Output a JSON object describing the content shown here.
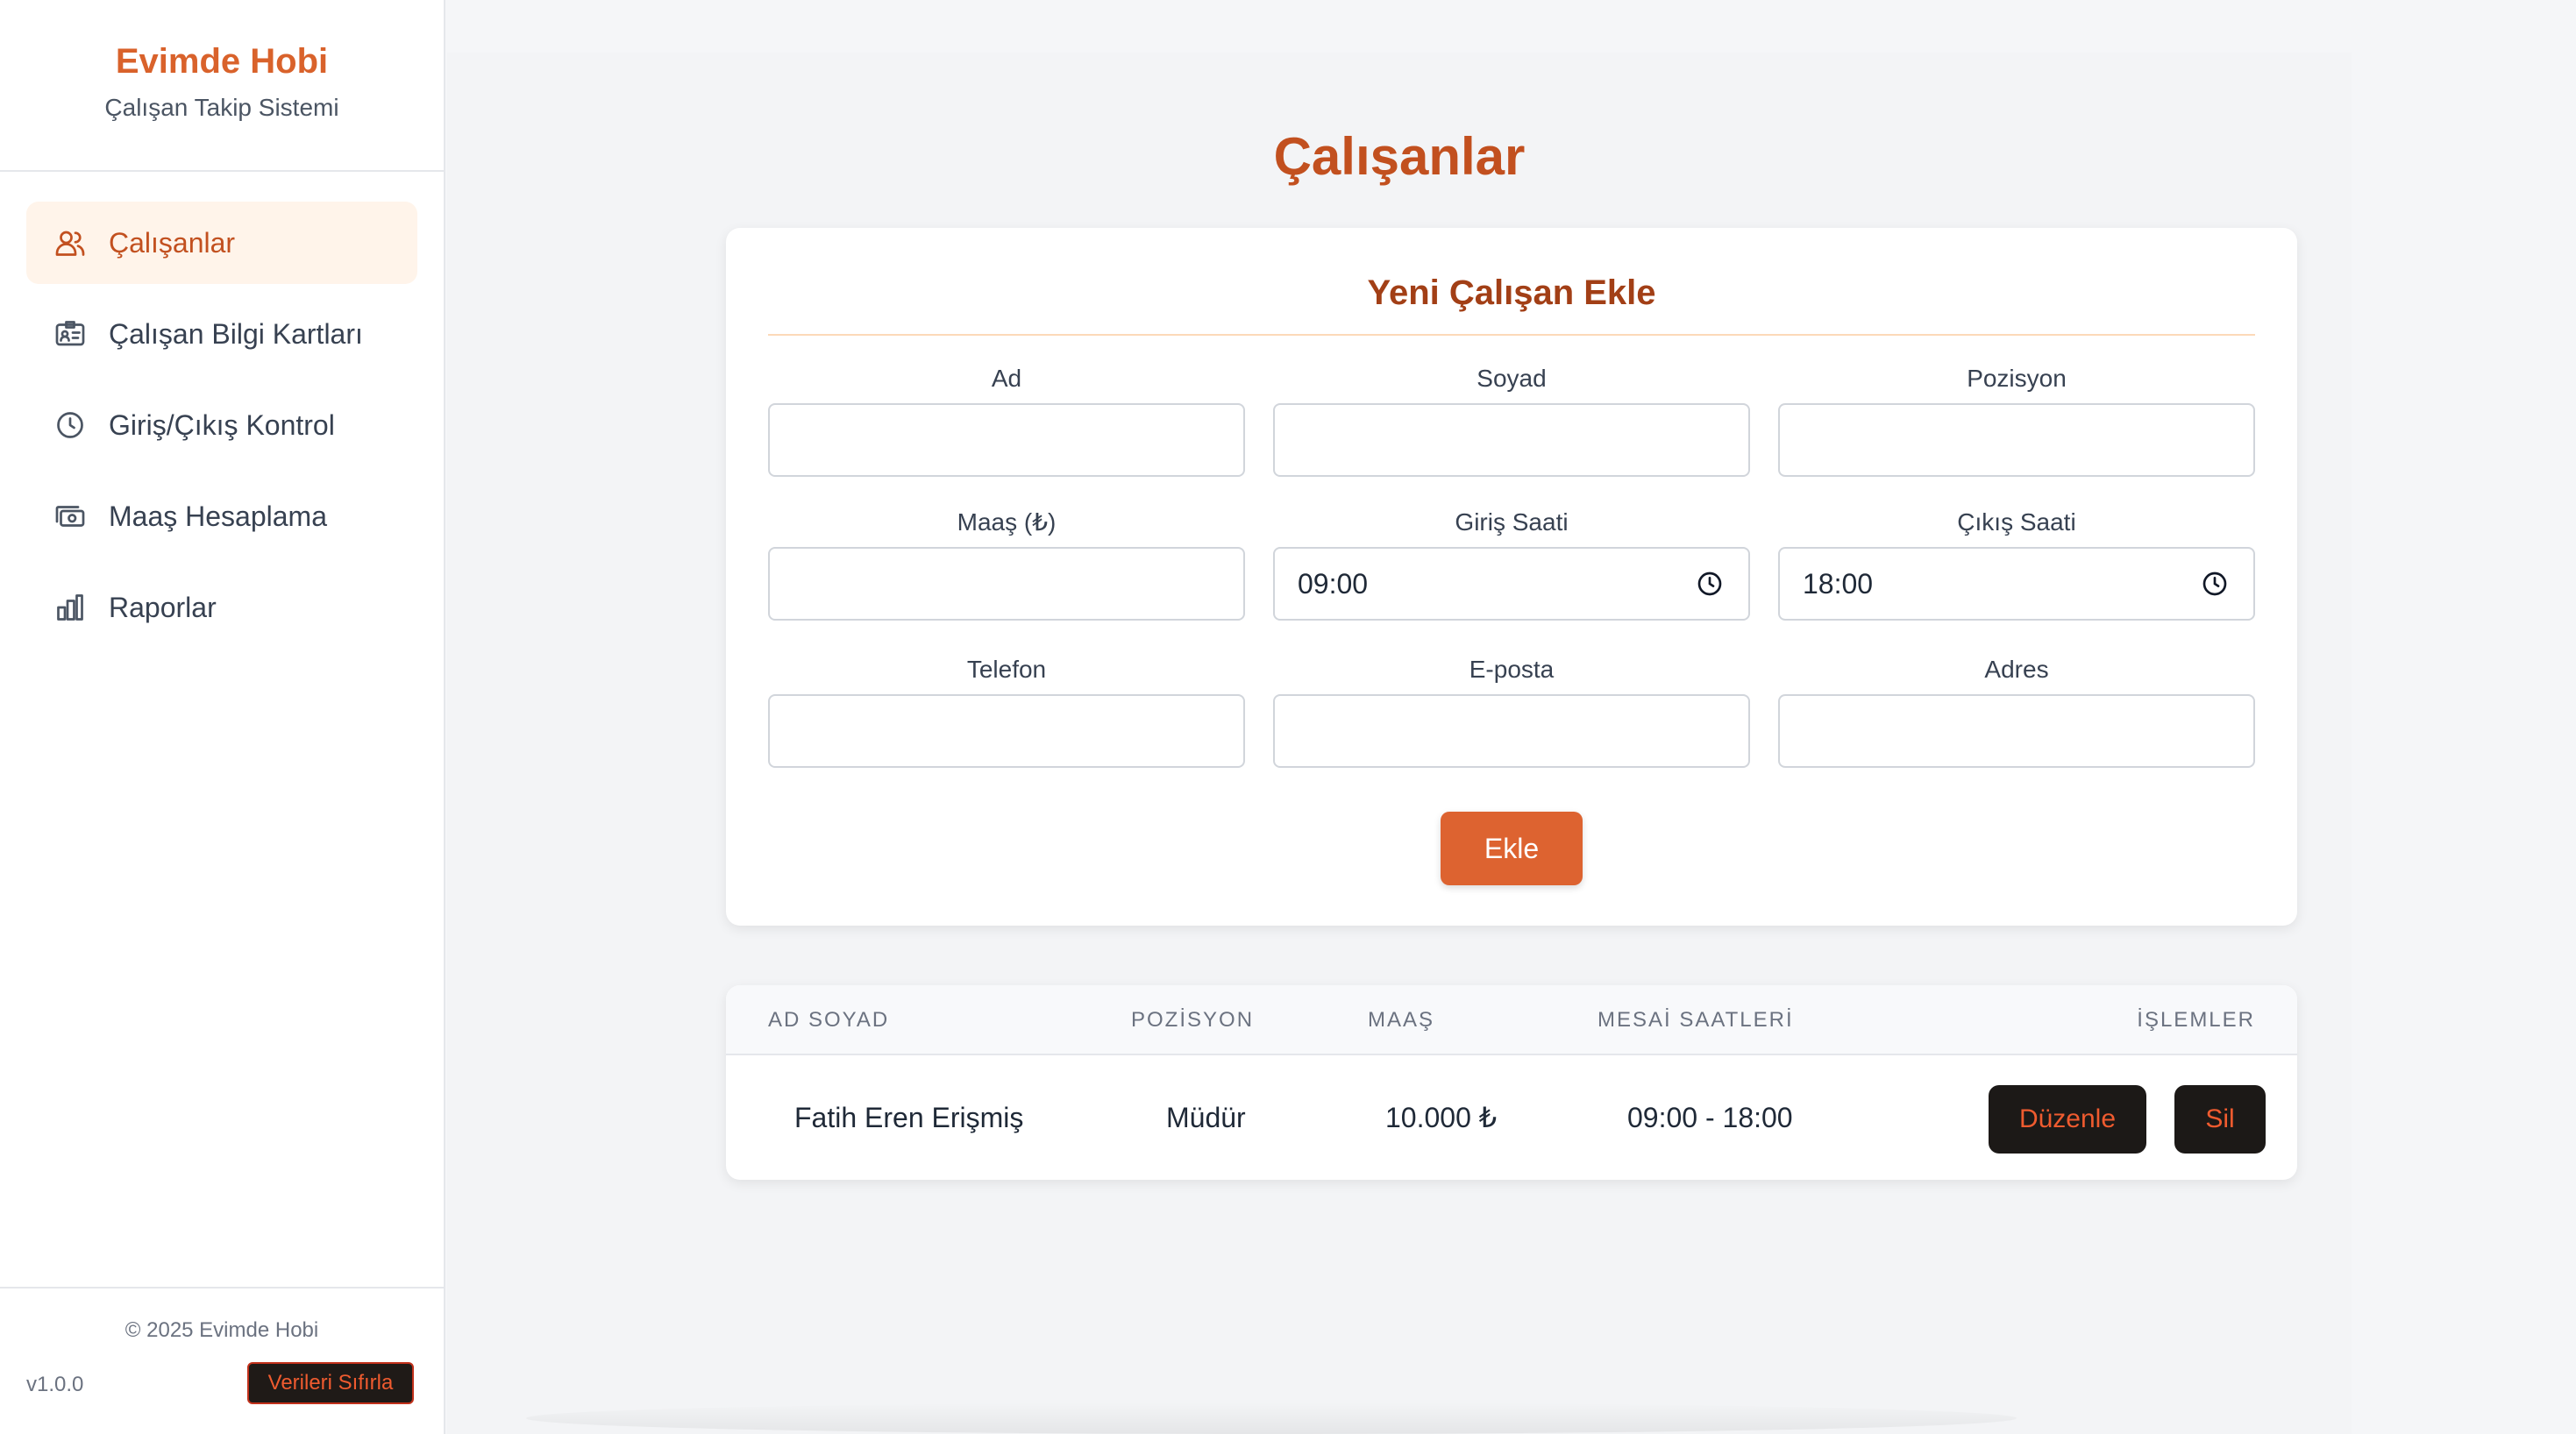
{
  "brand": {
    "title": "Evimde Hobi",
    "subtitle": "Çalışan Takip Sistemi"
  },
  "sidebar": {
    "items": [
      {
        "label": "Çalışanlar",
        "icon": "users-icon",
        "active": true
      },
      {
        "label": "Çalışan Bilgi Kartları",
        "icon": "id-card-icon",
        "active": false
      },
      {
        "label": "Giriş/Çıkış Kontrol",
        "icon": "clock-icon",
        "active": false
      },
      {
        "label": "Maaş Hesaplama",
        "icon": "money-icon",
        "active": false
      },
      {
        "label": "Raporlar",
        "icon": "bar-chart-icon",
        "active": false
      }
    ],
    "copyright": "© 2025 Evimde Hobi",
    "version": "v1.0.0",
    "reset_label": "Verileri Sıfırla"
  },
  "main": {
    "title": "Çalışanlar"
  },
  "form": {
    "title": "Yeni Çalışan Ekle",
    "fields": {
      "ad": {
        "label": "Ad",
        "value": ""
      },
      "soyad": {
        "label": "Soyad",
        "value": ""
      },
      "pozisyon": {
        "label": "Pozisyon",
        "value": ""
      },
      "maas": {
        "label": "Maaş (₺)",
        "value": ""
      },
      "giris": {
        "label": "Giriş Saati",
        "value": "09:00"
      },
      "cikis": {
        "label": "Çıkış Saati",
        "value": "18:00"
      },
      "telefon": {
        "label": "Telefon",
        "value": ""
      },
      "eposta": {
        "label": "E-posta",
        "value": ""
      },
      "adres": {
        "label": "Adres",
        "value": ""
      }
    },
    "submit_label": "Ekle"
  },
  "table": {
    "headers": [
      "AD SOYAD",
      "POZİSYON",
      "MAAŞ",
      "MESAİ SAATLERİ",
      "İŞLEMLER"
    ],
    "rows": [
      {
        "name": "Fatih Eren Erişmiş",
        "position": "Müdür",
        "salary": "10.000 ₺",
        "hours": "09:00 - 18:00",
        "edit_label": "Düzenle",
        "delete_label": "Sil"
      }
    ]
  },
  "colors": {
    "accent": "#dd6330",
    "title": "#c2501f",
    "danger": "#ef5b2f"
  }
}
